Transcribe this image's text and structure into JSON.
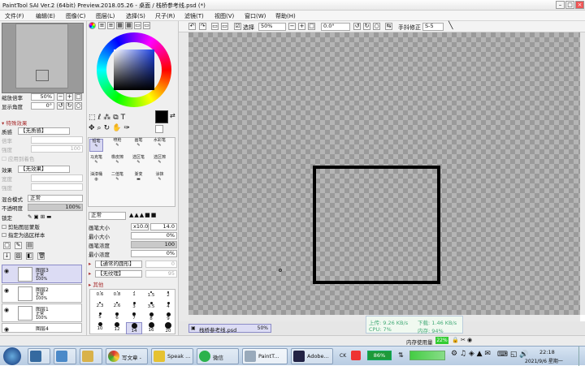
{
  "window": {
    "title": "PaintTool SAI Ver.2 (64bit) Preview.2018.05.26 - 桌面 / 栈桥参考线.psd (*)"
  },
  "menu": [
    "文件(F)",
    "编辑(E)",
    "图像(C)",
    "图层(L)",
    "选择(S)",
    "尺子(R)",
    "滤镜(T)",
    "视图(V)",
    "窗口(W)",
    "帮助(H)"
  ],
  "navigator": {
    "zoom_label": "缩放倍率",
    "zoom_value": "50%",
    "angle_label": "显示角度",
    "angle_value": "0°"
  },
  "layer_props": {
    "section_title": "特殊效果",
    "texture_label": "质感",
    "texture_value": "【无质感】",
    "scale_label": "倍率",
    "strength_label": "强度",
    "strength_value": "100",
    "apply_label": "应用到着色",
    "effect_label": "效果",
    "effect_value": "【无效果】",
    "width_label": "宽度",
    "effect_strength_label": "强度",
    "blend_label": "混合模式",
    "blend_value": "正常",
    "opacity_label": "不透明度",
    "opacity_value": "100%",
    "lock_label": "锁定",
    "clip_label": "剪贴图层蒙版",
    "clip2_label": "指定为选区样本"
  },
  "layers": [
    {
      "name": "图层3",
      "mode": "正常",
      "opacity": "100%"
    },
    {
      "name": "图层2",
      "mode": "正常",
      "opacity": "100%"
    },
    {
      "name": "图层1",
      "mode": "正常",
      "opacity": "100%"
    },
    {
      "name": "图层4"
    }
  ],
  "tools": {
    "row1": [
      "铅笔",
      "喷枪",
      "画笔",
      "水彩笔"
    ],
    "row2": [
      "马克笔",
      "橡皮擦",
      "选区笔",
      "选区擦"
    ],
    "row3": [
      "油漆桶",
      "二值笔",
      "渐变",
      "涂抹"
    ]
  },
  "brush_settings": {
    "mode_value": "正常",
    "size_label": "画笔大小",
    "size_mult": "x10.0",
    "size_value": "14.0",
    "min_size_label": "最小大小",
    "min_size_value": "0%",
    "density_label": "画笔浓度",
    "density_value": "100",
    "min_density_label": "最小浓度",
    "min_density_value": "0%",
    "shape_value": "【通常的圆形】",
    "shape_num": "0",
    "texture_value": "【无纹理】",
    "texture_num": "95",
    "other_label": "其他"
  },
  "brush_sizes": [
    "0.6",
    "0.8",
    "1",
    "1.5",
    "2",
    "2.3",
    "2.6",
    "3",
    "3.5",
    "4",
    "5",
    "6",
    "7",
    "8",
    "9",
    "10",
    "12",
    "14",
    "16",
    "20"
  ],
  "canvas_toolbar": {
    "select_label": "选择",
    "zoom_value": "50%",
    "angle_value": "0.0°",
    "stabilizer_label": "手抖修正",
    "stabilizer_value": "S-5"
  },
  "doc_tab": {
    "name": "栈桥参考线.psd",
    "zoom": "50%"
  },
  "status": {
    "memory_label": "内存使用量",
    "memory_value": "22%"
  },
  "network": {
    "upload": "上传: 9.26 KB/s",
    "download": "下载: 1.46 KB/s",
    "cpu": "CPU: 7%",
    "mem": "内存: 94%"
  },
  "taskbar": {
    "items": [
      "写文章 -",
      "Speak ...",
      "微信",
      "PaintT...",
      "Adobe..."
    ],
    "battery": "86%",
    "time": "22:18",
    "date": "2021/9/6 星期一"
  },
  "colors": {
    "accent": "#2b5fb0",
    "selected_layer": "#dcdcf4",
    "color_box": "#1e2e8a"
  }
}
